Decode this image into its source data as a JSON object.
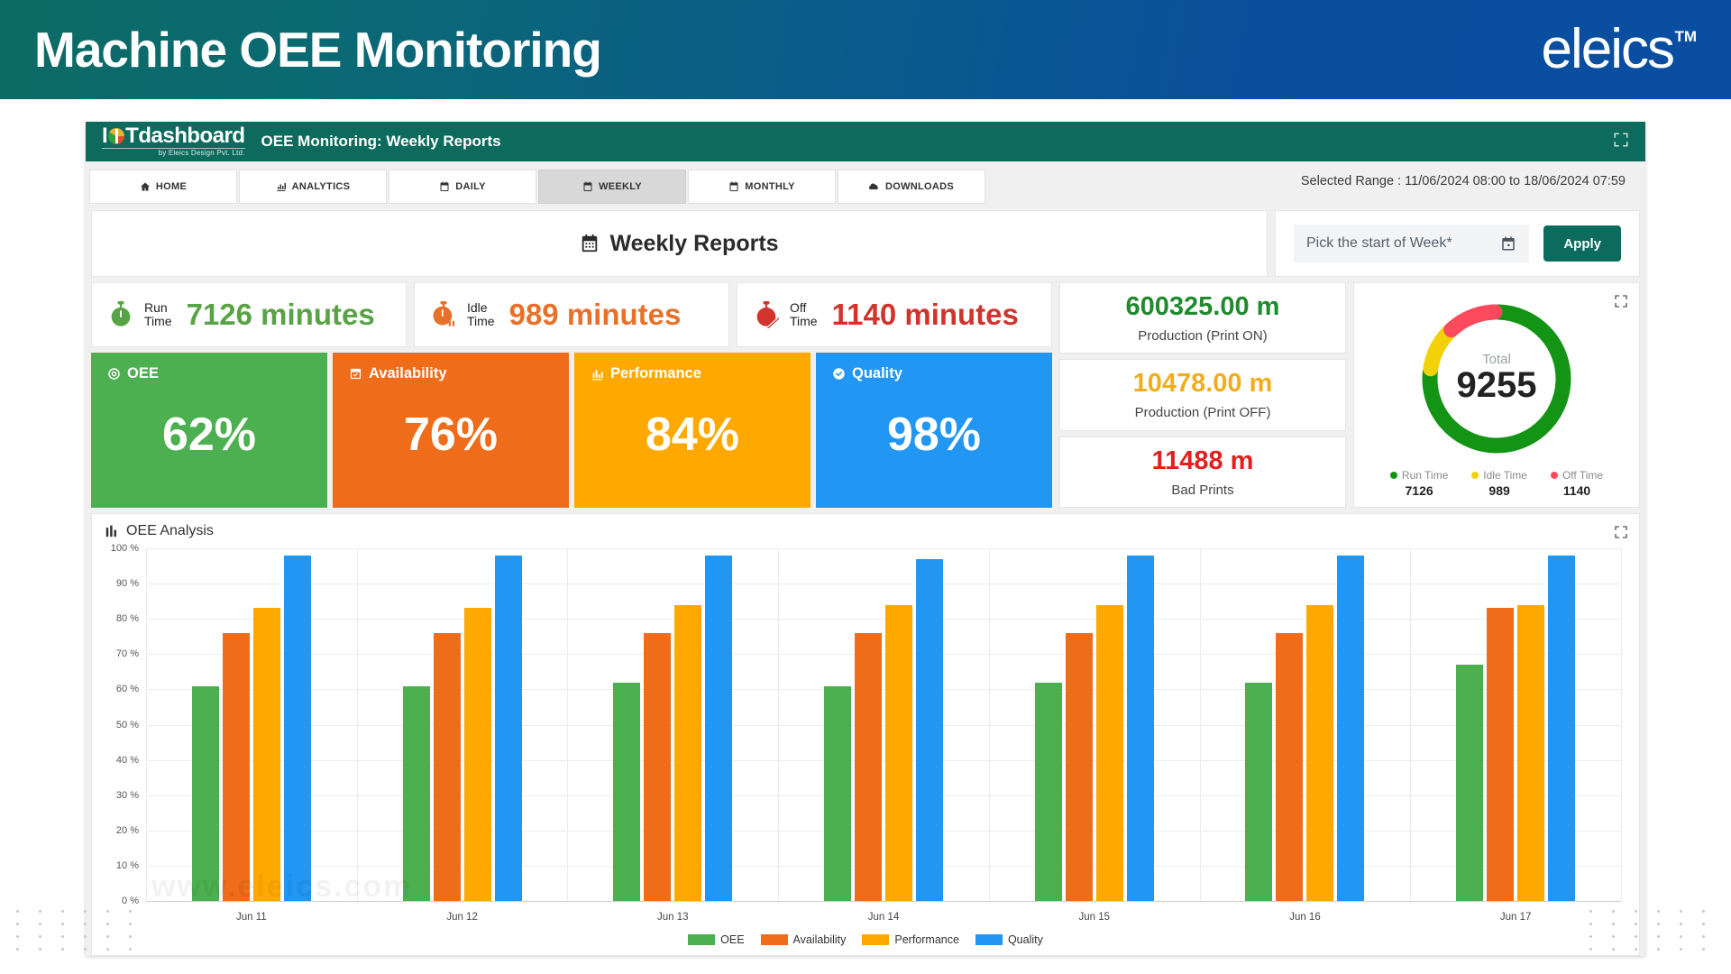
{
  "banner": {
    "title": "Machine OEE Monitoring",
    "brand": "eleics",
    "brand_tm": "TM"
  },
  "dashboard": {
    "logo_main": "dashboard",
    "logo_prefix": "I",
    "logo_t": "T",
    "logo_sub": "by Eleics Design Pvt. Ltd.",
    "subtitle": "OEE Monitoring: Weekly Reports",
    "tabs": [
      {
        "label": "HOME",
        "icon": "home-icon",
        "active": false
      },
      {
        "label": "ANALYTICS",
        "icon": "analytics-icon",
        "active": false
      },
      {
        "label": "DAILY",
        "icon": "calendar-icon",
        "active": false
      },
      {
        "label": "WEEKLY",
        "icon": "calendar-icon",
        "active": true
      },
      {
        "label": "MONTHLY",
        "icon": "calendar-icon",
        "active": false
      },
      {
        "label": "DOWNLOADS",
        "icon": "cloud-download-icon",
        "active": false
      }
    ],
    "selected_range": "Selected Range : 11/06/2024 08:00 to 18/06/2024 07:59",
    "report_title": "Weekly Reports",
    "date_placeholder": "Pick the start of Week*",
    "apply_label": "Apply"
  },
  "time_cards": [
    {
      "label_line1": "Run",
      "label_line2": "Time",
      "value": "7126 minutes",
      "color": "#58a345",
      "icon": "stopwatch-icon"
    },
    {
      "label_line1": "Idle",
      "label_line2": "Time",
      "value": "989 minutes",
      "color": "#e8712a",
      "icon": "stopwatch-pause-icon"
    },
    {
      "label_line1": "Off",
      "label_line2": "Time",
      "value": "1140 minutes",
      "color": "#d0342c",
      "icon": "stopwatch-off-icon"
    }
  ],
  "metric_tiles": [
    {
      "label": "OEE",
      "value": "62%",
      "bg": "#4caf50",
      "icon": "target-icon"
    },
    {
      "label": "Availability",
      "value": "76%",
      "bg": "#ef6c1a",
      "icon": "calendar-check-icon"
    },
    {
      "label": "Performance",
      "value": "84%",
      "bg": "#ffa800",
      "icon": "bar-chart-icon"
    },
    {
      "label": "Quality",
      "value": "98%",
      "bg": "#2196f3",
      "icon": "check-circle-icon"
    }
  ],
  "production_cards": [
    {
      "value": "600325.00 m",
      "label": "Production (Print ON)",
      "color": "#1f8a2e"
    },
    {
      "value": "10478.00 m",
      "label": "Production (Print OFF)",
      "color": "#f0ad1e"
    },
    {
      "value": "11488 m",
      "label": "Bad Prints",
      "color": "#e12020"
    }
  ],
  "donut": {
    "total_label": "Total",
    "total_value": "9255",
    "segments": [
      {
        "name": "Run Time",
        "value": 7126,
        "color": "#149414"
      },
      {
        "name": "Idle Time",
        "value": 989,
        "color": "#f2d108"
      },
      {
        "name": "Off Time",
        "value": 1140,
        "color": "#fa4a5c"
      }
    ]
  },
  "chart_card": {
    "title": "OEE Analysis",
    "expand_icon": "expand-icon"
  },
  "chart_data": {
    "type": "bar",
    "title": "OEE Analysis",
    "xlabel": "",
    "ylabel": "",
    "ylim": [
      0,
      100
    ],
    "grid": true,
    "legend_position": "bottom",
    "y_ticks": [
      "100 %",
      "90 %",
      "80 %",
      "70 %",
      "60 %",
      "50 %",
      "40 %",
      "30 %",
      "20 %",
      "10 %",
      "0 %"
    ],
    "categories": [
      "Jun 11",
      "Jun 12",
      "Jun 13",
      "Jun 14",
      "Jun 15",
      "Jun 16",
      "Jun 17"
    ],
    "series": [
      {
        "name": "OEE",
        "color": "#4caf50",
        "values": [
          61,
          61,
          62,
          61,
          62,
          62,
          67
        ]
      },
      {
        "name": "Availability",
        "color": "#ef6c1a",
        "values": [
          76,
          76,
          76,
          76,
          76,
          76,
          83
        ]
      },
      {
        "name": "Performance",
        "color": "#ffa800",
        "values": [
          83,
          83,
          84,
          84,
          84,
          84,
          84
        ]
      },
      {
        "name": "Quality",
        "color": "#2196f3",
        "values": [
          98,
          98,
          98,
          97,
          98,
          98,
          98
        ]
      }
    ]
  },
  "watermark": "www.eleics.com"
}
